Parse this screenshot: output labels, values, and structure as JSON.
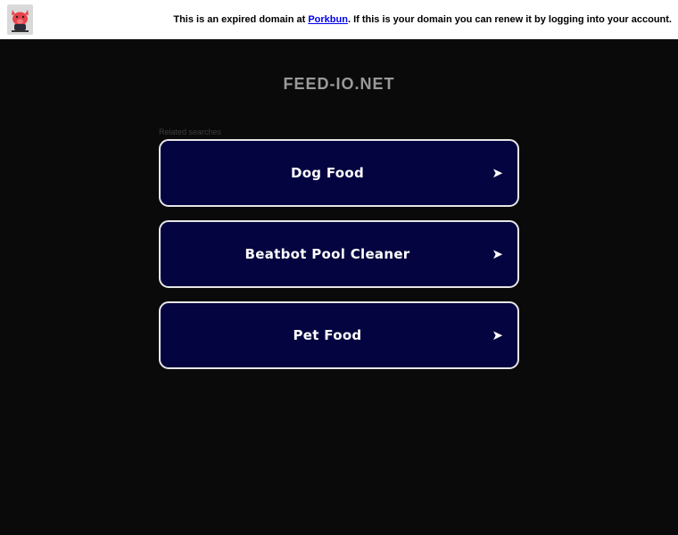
{
  "topbar": {
    "logo_icon": "porkbun-pig-logo-icon",
    "notice_before": "This is an expired domain at ",
    "notice_link": "Porkbun",
    "notice_after": ". If this is your domain you can renew it by logging into your account."
  },
  "domain": {
    "title": "FEED-IO.NET"
  },
  "related": {
    "label": "Related searches",
    "items": [
      {
        "label": "Dog Food",
        "arrow": "➤"
      },
      {
        "label": "Beatbot Pool Cleaner",
        "arrow": "➤"
      },
      {
        "label": "Pet Food",
        "arrow": "➤"
      }
    ]
  },
  "colors": {
    "page_background": "#0a0a0a",
    "button_background": "#040440",
    "button_border": "#e6e6e6",
    "title_text": "#9a9a9a",
    "link": "#0000ee"
  }
}
